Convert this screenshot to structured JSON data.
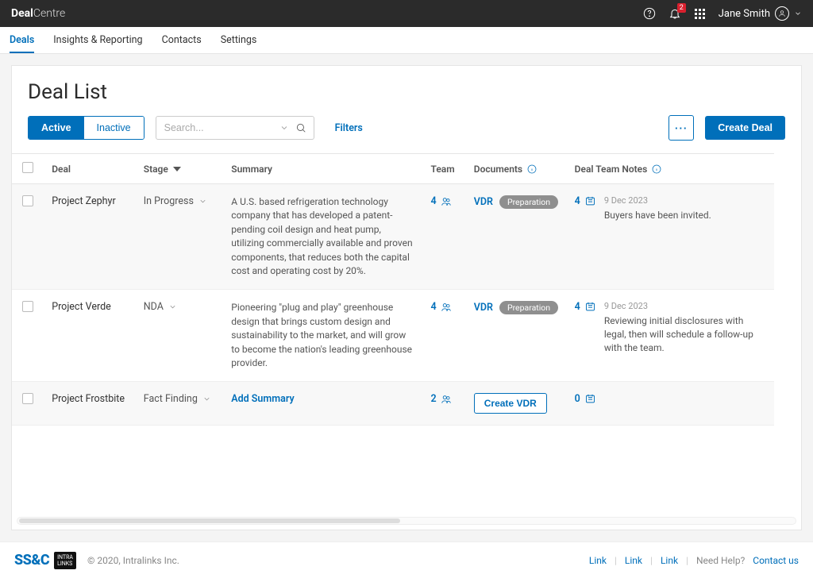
{
  "brand": {
    "bold": "Deal",
    "light": "Centre"
  },
  "notifications": {
    "count": "2"
  },
  "user": {
    "name": "Jane Smith"
  },
  "nav": [
    "Deals",
    "Insights & Reporting",
    "Contacts",
    "Settings"
  ],
  "page": {
    "title": "Deal List"
  },
  "segments": {
    "active": "Active",
    "inactive": "Inactive"
  },
  "search": {
    "placeholder": "Search..."
  },
  "filters_label": "Filters",
  "more_label": "···",
  "create_label": "Create Deal",
  "columns": {
    "deal": "Deal",
    "stage": "Stage",
    "summary": "Summary",
    "team": "Team",
    "documents": "Documents",
    "notes": "Deal Team Notes"
  },
  "rows": [
    {
      "deal": "Project Zephyr",
      "stage": "In Progress",
      "summary": "A U.S. based refrigeration technology company that has developed a patent-pending coil design and heat pump, utilizing commercially available and proven components, that reduces both the capital cost and operating cost by 20%.",
      "team": "4",
      "doc_link": "VDR",
      "doc_status": "Preparation",
      "notes_count": "4",
      "note_date": "9 Dec 2023",
      "note_text": "Buyers have been invited."
    },
    {
      "deal": "Project Verde",
      "stage": "NDA",
      "summary": "Pioneering \"plug and play\" greenhouse design that brings custom design and sustainability to the market, and will grow to become the nation's leading greenhouse provider.",
      "team": "4",
      "doc_link": "VDR",
      "doc_status": "Preparation",
      "notes_count": "4",
      "note_date": "9 Dec 2023",
      "note_text": "Reviewing initial disclosures with legal, then will schedule a follow-up with the team."
    },
    {
      "deal": "Project Frostbite",
      "stage": "Fact Finding",
      "summary_action": "Add Summary",
      "team": "2",
      "create_vdr": "Create VDR",
      "notes_count": "0"
    }
  ],
  "footer": {
    "copyright": "© 2020, Intralinks Inc.",
    "links": [
      "Link",
      "Link",
      "Link"
    ],
    "help_label": "Need Help?",
    "contact": "Contact us",
    "logo_text": "SS&C",
    "il_top": "INTRA",
    "il_bot": "LINKS"
  }
}
